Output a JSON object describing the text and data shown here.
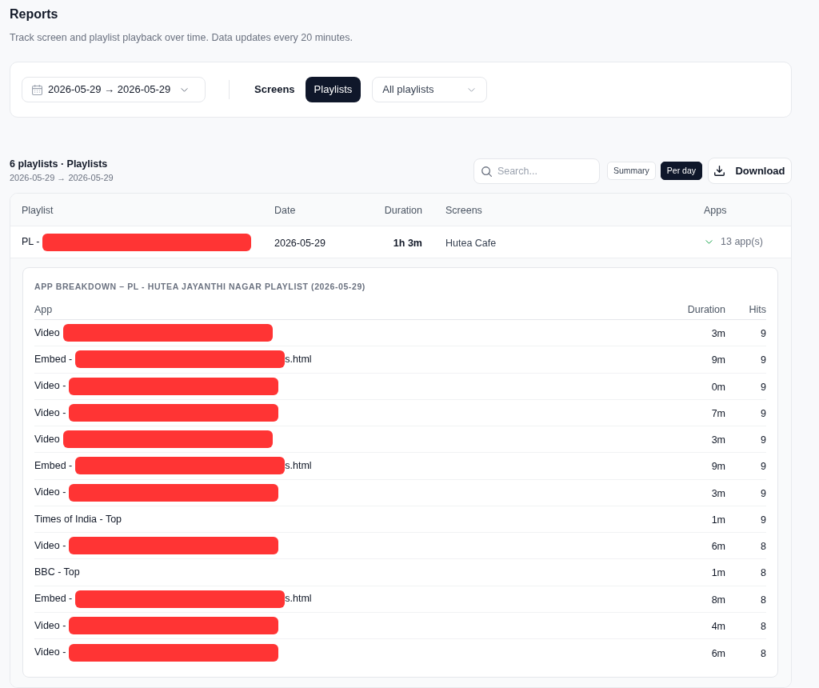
{
  "header": {
    "title": "Reports",
    "subtitle": "Track screen and playlist playback over time. Data updates every 20 minutes."
  },
  "filters": {
    "date_range": "2026-05-29 → 2026-05-29",
    "tabs": [
      {
        "label": "Screens",
        "selected": false
      },
      {
        "label": "Playlists",
        "selected": true
      }
    ],
    "playlist_select": {
      "value": "All playlists"
    }
  },
  "results": {
    "title": "6 playlists · Playlists",
    "date_range": "2026-05-29 → 2026-05-29",
    "search": {
      "placeholder": "Search..."
    },
    "views": [
      {
        "label": "Summary",
        "selected": false
      },
      {
        "label": "Per day",
        "selected": true
      }
    ],
    "download": "Download"
  },
  "table": {
    "columns": [
      "Playlist",
      "Date",
      "Duration",
      "Screens",
      "Apps"
    ],
    "rows": [
      {
        "name": "PL -",
        "redacted": true,
        "date": "2026-05-29",
        "duration": "1h 3m",
        "screens": "Hutea Cafe",
        "apps": "13 app(s)",
        "expanded": true,
        "breakdown": {
          "title": "APP BREAKDOWN – PL - HUTEA JAYANTHI NAGAR PLAYLIST (2026-05-29)",
          "columns": [
            "App",
            "Duration",
            "Hits"
          ],
          "rows": [
            {
              "name": "Video",
              "redacted": true,
              "duration": "3m",
              "hits": "9"
            },
            {
              "name": "Embed -",
              "redacted": true,
              "suffix": "s.html",
              "duration": "9m",
              "hits": "9"
            },
            {
              "name": "Video -",
              "redacted": true,
              "duration": "0m",
              "hits": "9"
            },
            {
              "name": "Video -",
              "redacted": true,
              "duration": "7m",
              "hits": "9"
            },
            {
              "name": "Video",
              "redacted": true,
              "duration": "3m",
              "hits": "9"
            },
            {
              "name": "Embed -",
              "redacted": true,
              "suffix": "s.html",
              "duration": "9m",
              "hits": "9"
            },
            {
              "name": "Video -",
              "redacted": true,
              "duration": "3m",
              "hits": "9"
            },
            {
              "name": "Times of India - Top",
              "redacted": false,
              "duration": "1m",
              "hits": "9"
            },
            {
              "name": "Video -",
              "redacted": true,
              "duration": "6m",
              "hits": "8"
            },
            {
              "name": "BBC - Top",
              "redacted": false,
              "duration": "1m",
              "hits": "8"
            },
            {
              "name": "Embed -",
              "redacted": true,
              "suffix": "s.html",
              "duration": "8m",
              "hits": "8"
            },
            {
              "name": "Video -",
              "redacted": true,
              "duration": "4m",
              "hits": "8"
            },
            {
              "name": "Video -",
              "redacted": true,
              "duration": "6m",
              "hits": "8"
            }
          ]
        }
      }
    ]
  }
}
